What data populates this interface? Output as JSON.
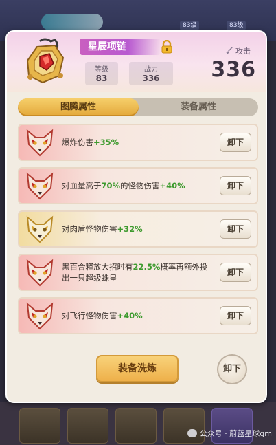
{
  "background": {
    "level_badges": [
      "83级",
      "83级"
    ],
    "watermark": "公众号 · 蔚蓝星球gm"
  },
  "item": {
    "name": "星辰项链",
    "locked": true,
    "level_label": "等级",
    "level_value": "83",
    "power_label": "战力",
    "power_value": "336",
    "attack_label": "攻击",
    "attack_value": "336",
    "icon": "necklace-icon"
  },
  "tabs": [
    {
      "label": "图腾属性",
      "active": true
    },
    {
      "label": "装备属性",
      "active": false
    }
  ],
  "totems": [
    {
      "mask": "red-fox-mask-icon",
      "text_pre": "爆炸伤害",
      "highlight": "+35%",
      "text_post": "",
      "button": "卸下"
    },
    {
      "mask": "red-fox-mask-icon",
      "text_pre": "对血量高于",
      "highlight": "70%",
      "text_mid": "的怪物伤害",
      "highlight2": "+40%",
      "button": "卸下"
    },
    {
      "mask": "gold-fox-mask-icon",
      "text_pre": "对肉盾怪物伤害",
      "highlight": "+32%",
      "text_post": "",
      "button": "卸下"
    },
    {
      "mask": "red-fox-mask-icon",
      "text_pre": "黑百合释放大招时有",
      "highlight": "22.5%",
      "text_post": "概率再额外投出一只超级蛛皇",
      "button": "卸下"
    },
    {
      "mask": "red-fox-mask-icon",
      "text_pre": "对飞行怪物伤害",
      "highlight": "+40%",
      "text_post": "",
      "button": "卸下"
    }
  ],
  "actions": {
    "refine_label": "装备洗炼",
    "unequip_label": "卸下"
  },
  "colors": {
    "highlight": "#3d9a2e",
    "tab_active": "#e3a83a",
    "name_banner": "#c95fc0"
  }
}
